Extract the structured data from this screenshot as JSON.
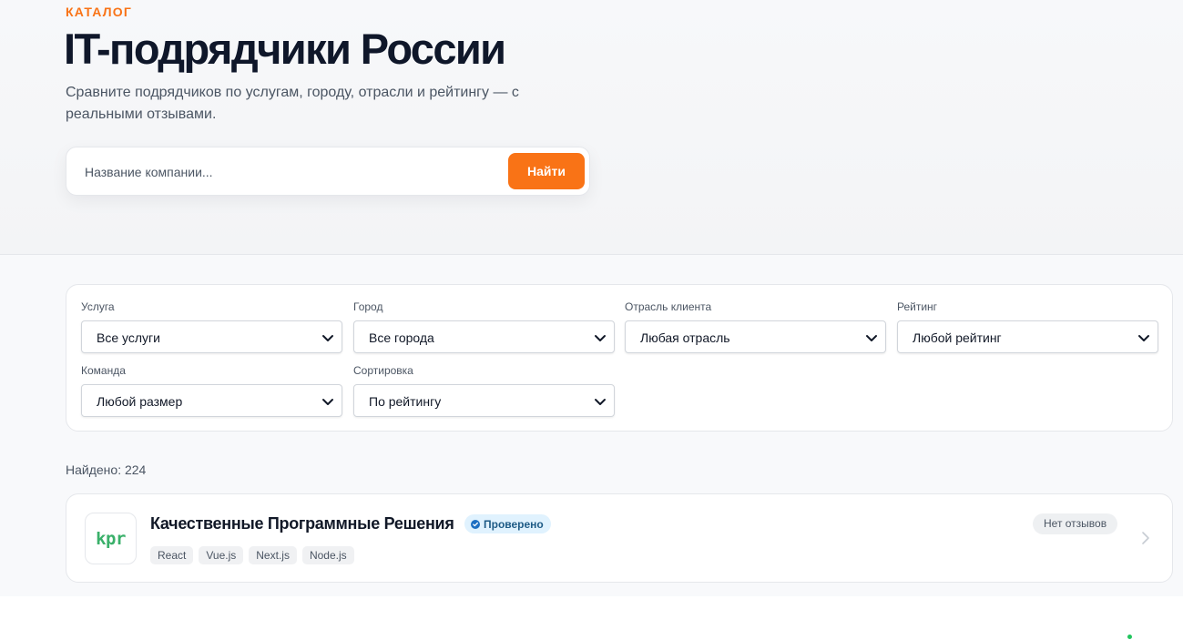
{
  "hero": {
    "eyebrow": "КАТАЛОГ",
    "title": "IT-подрядчики России",
    "subtitle": "Сравните подрядчиков по услугам, городу, отрасли и рейтингу — с реальными отзывами."
  },
  "search": {
    "placeholder": "Название компании...",
    "value": "",
    "button_label": "Найти"
  },
  "filters": [
    {
      "label": "Услуга",
      "value": "Все услуги"
    },
    {
      "label": "Город",
      "value": "Все города"
    },
    {
      "label": "Отрасль клиента",
      "value": "Любая отрасль"
    },
    {
      "label": "Рейтинг",
      "value": "Любой рейтинг"
    },
    {
      "label": "Команда",
      "value": "Любой размер"
    },
    {
      "label": "Сортировка",
      "value": "По рейтингу"
    }
  ],
  "results": {
    "found_label": "Найдено: 224"
  },
  "companies": [
    {
      "logo_text": "kpr",
      "name": "Качественные Программные Решения",
      "verified_label": "Проверено",
      "tags": [
        "React",
        "Vue.js",
        "Next.js",
        "Node.js"
      ],
      "reviews_label": "Нет отзывов"
    }
  ],
  "colors": {
    "accent": "#f97316",
    "title": "#0f172a",
    "logo": "#3ab06a",
    "verified_bg": "#e0f2fe",
    "verified_text": "#1e5b86"
  },
  "icons": [
    "chevron-down-icon",
    "check-icon",
    "chevron-right-icon"
  ]
}
